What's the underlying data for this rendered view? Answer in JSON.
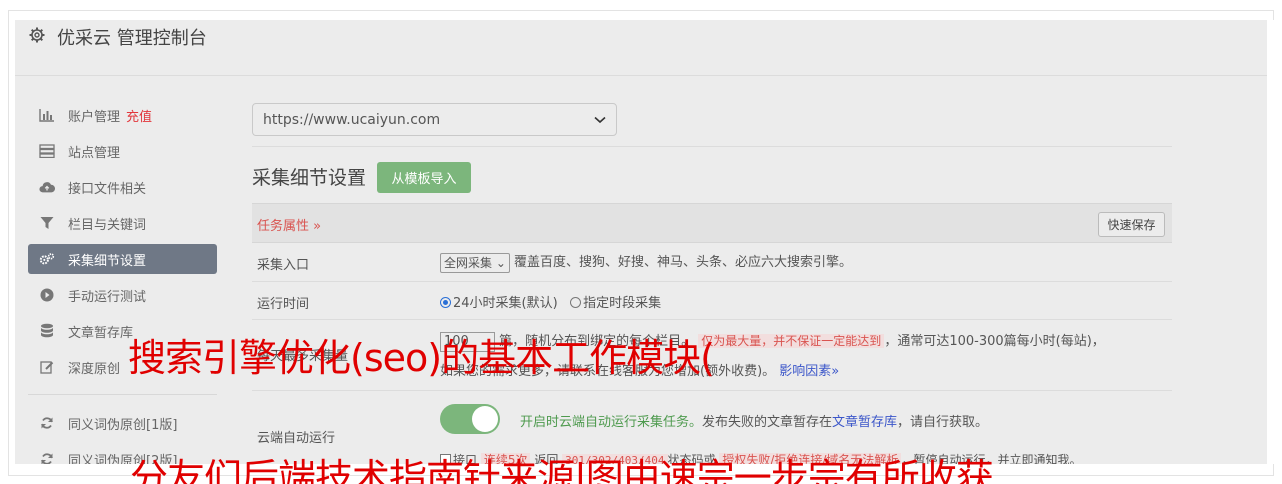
{
  "header": {
    "title": "优采云 管理控制台"
  },
  "sidebar": {
    "items": [
      {
        "label": "账户管理",
        "extra": "充值",
        "icon": "bar-chart-icon"
      },
      {
        "label": "站点管理",
        "icon": "server-icon"
      },
      {
        "label": "接口文件相关",
        "icon": "cloud-upload-icon"
      },
      {
        "label": "栏目与关键词",
        "icon": "filter-icon"
      },
      {
        "label": "采集细节设置",
        "icon": "gears-icon"
      },
      {
        "label": "手动运行测试",
        "icon": "play-circle-icon"
      },
      {
        "label": "文章暂存库",
        "icon": "database-icon"
      },
      {
        "label": "深度原创",
        "icon": "edit-icon"
      },
      {
        "label": "同义词伪原创[1版]",
        "icon": "refresh-icon"
      },
      {
        "label": "同义词伪原创[2版]",
        "icon": "refresh-icon"
      }
    ]
  },
  "main": {
    "site_url": "https://www.ucaiyun.com",
    "section_title": "采集细节设置",
    "import_button": "从模板导入",
    "task_attr": "任务属性 »",
    "quick_save": "快速保存",
    "rows": {
      "entry": {
        "label": "采集入口",
        "select": "全网采集",
        "desc": "覆盖百度、搜狗、好搜、神马、头条、必应六大搜索引擎。"
      },
      "runtime": {
        "label": "运行时间",
        "opt1": "24小时采集(默认)",
        "opt2": "指定时段采集"
      },
      "count": {
        "label": "每天最多采集量",
        "value": "100",
        "text1": "篇，随机分布到绑定的每个栏目。",
        "pink": "仅为最大量，并不保证一定能达到",
        "text2": "，通常可达100-300篇每小时(每站)，",
        "line2": "如果您的需求更多，请联系在线客服为您增加(额外收费)。",
        "link": "影响因素»"
      },
      "cloud": {
        "label": "云端自动运行",
        "text1": "开启时云端自动运行采集任务。",
        "text2": "发布失败的文章暂存在",
        "link": "文章暂存库",
        "text3": "，请自行获取。",
        "sub1": "接口",
        "sub2": "连续5次",
        "sub3": "返回",
        "codes": "301/302/403/404",
        "sub4": "状态码或",
        "sub5": "授权失败/拒绝连接/域名无法解析",
        "sub6": "，暂停自动运行，并立即通知我。"
      }
    }
  },
  "overlay": {
    "line1": "搜索引擎优化(seo)的基本工作模块(",
    "line2": "分友们后端技术指南针来源|图由速宗一步宗有所收获"
  }
}
